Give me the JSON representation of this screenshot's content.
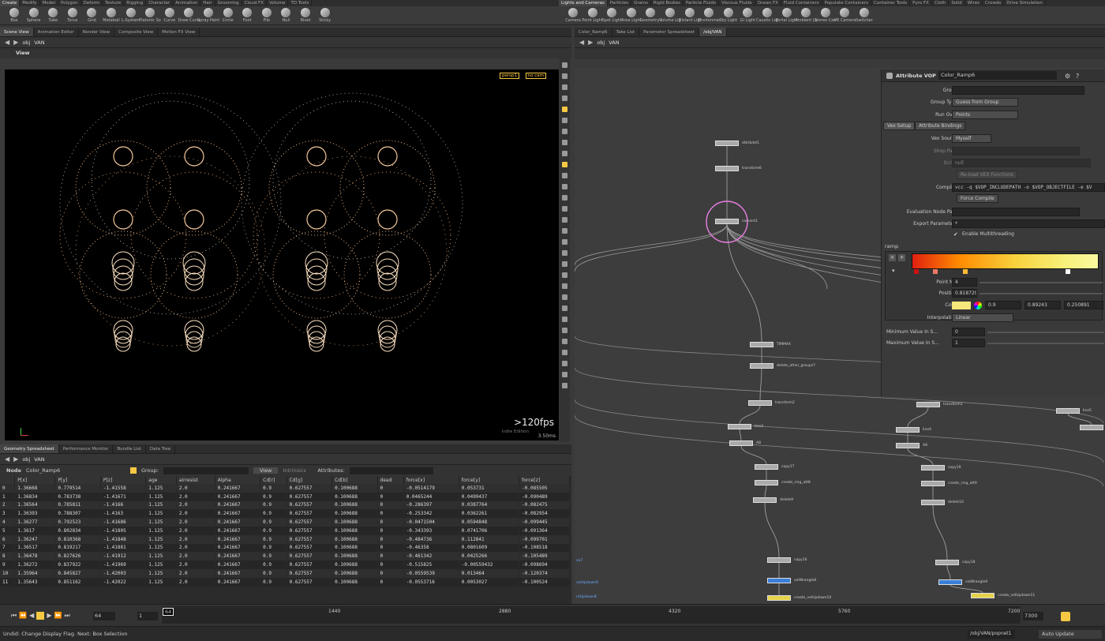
{
  "shelf_tabs_left": [
    "Create",
    "Modify",
    "Model",
    "Polygon",
    "Deform",
    "Texture",
    "Rigging",
    "Character",
    "Animation",
    "Hair",
    "Grooming",
    "Cloud FX",
    "Volume",
    "TD Tools"
  ],
  "shelf_tabs_right": [
    "Lights and Cameras",
    "Particles",
    "Grains",
    "Rigid Bodies",
    "Particle Fluids",
    "Viscous Fluids",
    "Ocean FX",
    "Fluid Containers",
    "Populate Containers",
    "Container Tools",
    "Pyro FX",
    "Cloth",
    "Solid",
    "Wires",
    "Crowds",
    "Drive Simulation"
  ],
  "tools_left": [
    "Box",
    "Sphere",
    "Tube",
    "Torus",
    "Grid",
    "Metaball",
    "L-System",
    "Platonic Sol...",
    "Curve",
    "Draw Curve",
    "Spray Paint",
    "Circle",
    "Font",
    "File",
    "Null",
    "Rivet",
    "Sticky"
  ],
  "tools_right": [
    "Camera",
    "Point Light",
    "Spot Light",
    "Area Light",
    "Geometry L...",
    "Volume Light",
    "Distant Light",
    "Environmen...",
    "Sky Light",
    "GI Light",
    "Caustic Light",
    "Portal Light",
    "Ambient Lig...",
    "Stereo Cam...",
    "VR Camera",
    "Switcher"
  ],
  "left_tabs": [
    "Scene View",
    "Animation Editor",
    "Render View",
    "Composite View",
    "Motion FX View"
  ],
  "right_tabs": [
    "Color_Ramp6",
    "Take List",
    "Parameter Spreadsheet",
    "/obj/VAN"
  ],
  "path": {
    "root": "obj",
    "node": "VAN"
  },
  "viewport": {
    "title": "View",
    "camera": "persp1",
    "cam2": "no cam",
    "fps": ">120fps",
    "fps_sub": "3.50ms",
    "watermark": "Indie Edition"
  },
  "net_nodes": [
    {
      "label": "attribdel1"
    },
    {
      "label": "transform6"
    },
    {
      "label": "convert1"
    },
    {
      "label": "TIMMAX"
    },
    {
      "label": "delete_other_groups7"
    },
    {
      "label": "transform2"
    },
    {
      "label": "line3"
    },
    {
      "label": "A8"
    },
    {
      "label": "copy17"
    },
    {
      "label": "create_ring_att8"
    },
    {
      "label": "delete9"
    },
    {
      "label": "copy16"
    },
    {
      "label": "velWrangle8"
    },
    {
      "label": "create_velUpdown10"
    },
    {
      "label": "transform1"
    },
    {
      "label": "line4"
    },
    {
      "label": "A8"
    },
    {
      "label": "copy19"
    },
    {
      "label": "create_ring_att9"
    },
    {
      "label": "delete10"
    },
    {
      "label": "copy18"
    },
    {
      "label": "velWrangle9"
    },
    {
      "label": "create_velUpdown11"
    },
    {
      "label": "line5"
    },
    {
      "label": "A11"
    }
  ],
  "net_side_labels": [
    "ve7",
    "velUpdown9",
    "ntUpdown8"
  ],
  "params": {
    "type": "Attribute VOP",
    "name": "Color_Ramp6",
    "group_label": "Group",
    "group_type_label": "Group Type",
    "group_type": "Guess from Group",
    "run_over_label": "Run Over",
    "run_over": "Points",
    "tab_vex": "Vex Setup",
    "tab_bind": "Attribute Bindings",
    "vex_source_label": "Vex Source",
    "vex_source": "Myself",
    "shop_path_label": "Shop Path",
    "script_label": "Script",
    "script_value": "null",
    "reload": "Re-load VEX Functions",
    "compiler_label": "Compiler",
    "compiler": "vcc -q $VOP_INCLUDEPATH -o $VOP_OBJECTFILE -e $V",
    "force_compile": "Force Compile",
    "eval_path_label": "Evaluation Node Path",
    "export_label": "Export Parameters",
    "export_value": "*",
    "multithread": "Enable Multithreading",
    "ramp_label": "ramp",
    "point_no_label": "Point No.",
    "point_no": "4",
    "position_label": "Position",
    "position": "0.818729",
    "color_label": "Color",
    "color_r": "0.9",
    "color_g": "0.89243",
    "color_b": "0.250891",
    "interp_label": "Interpolation",
    "interp": "Linear",
    "min_label": "Minimum Value In S...",
    "min_value": "0",
    "max_label": "Maximum Value In S...",
    "max_value": "1"
  },
  "sheet_tabs": [
    "Geometry Spreadsheet",
    "Performance Monitor",
    "Bundle List",
    "Data Tree"
  ],
  "sheet": {
    "node_label": "Node",
    "node": "Color_Ramp6",
    "group_label": "Group:",
    "view": "View",
    "intrinsics": "Intrinsics",
    "attributes_label": "Attributes:",
    "columns": [
      "",
      "P[x]",
      "P[y]",
      "P[z]",
      "age",
      "airresist",
      "Alpha",
      "Cd[r]",
      "Cd[g]",
      "Cd[b]",
      "dead",
      "force[x]",
      "force[y]",
      "force[z]"
    ],
    "rows": [
      [
        "0",
        "1.36668",
        "0.779514",
        "-1.41558",
        "1.125",
        "2.0",
        "0.241667",
        "0.9",
        "0.627557",
        "0.100688",
        "0",
        "-0.0514179",
        "0.053731",
        "-0.085505"
      ],
      [
        "1",
        "1.36834",
        "0.783738",
        "-1.41671",
        "1.125",
        "2.0",
        "0.241667",
        "0.9",
        "0.627557",
        "0.100688",
        "0",
        "0.0465244",
        "0.0499437",
        "-0.090489"
      ],
      [
        "2",
        "1.36564",
        "0.785811",
        "-1.4166",
        "1.125",
        "2.0",
        "0.241667",
        "0.9",
        "0.627557",
        "0.100688",
        "0",
        "-0.286397",
        "0.0387764",
        "-0.082475"
      ],
      [
        "3",
        "1.36393",
        "0.788307",
        "-1.4163",
        "1.125",
        "2.0",
        "0.241667",
        "0.9",
        "0.627557",
        "0.100688",
        "0",
        "-0.253342",
        "0.0362261",
        "-0.082954"
      ],
      [
        "4",
        "1.36277",
        "0.792523",
        "-1.41686",
        "1.125",
        "2.0",
        "0.241667",
        "0.9",
        "0.627557",
        "0.100688",
        "0",
        "-0.0471504",
        "0.0594848",
        "-0.099445"
      ],
      [
        "5",
        "1.3617",
        "0.802834",
        "-1.41805",
        "1.125",
        "2.0",
        "0.241667",
        "0.9",
        "0.627557",
        "0.100688",
        "0",
        "-0.343393",
        "0.0741706",
        "-0.091364"
      ],
      [
        "6",
        "1.36247",
        "0.810368",
        "-1.41848",
        "1.125",
        "2.0",
        "0.241667",
        "0.9",
        "0.627557",
        "0.100688",
        "0",
        "-0.484736",
        "0.112841",
        "-0.099701"
      ],
      [
        "7",
        "1.36517",
        "0.819217",
        "-1.41881",
        "1.125",
        "2.0",
        "0.241667",
        "0.9",
        "0.627557",
        "0.100688",
        "0",
        "-0.46358",
        "0.0801609",
        "-0.108518"
      ],
      [
        "8",
        "1.36478",
        "0.827626",
        "-1.41912",
        "1.125",
        "2.0",
        "0.241667",
        "0.9",
        "0.627557",
        "0.100688",
        "0",
        "-0.461342",
        "0.0425266",
        "-0.105489"
      ],
      [
        "9",
        "1.36272",
        "0.837922",
        "-1.41969",
        "1.125",
        "2.0",
        "0.241667",
        "0.9",
        "0.627557",
        "0.100688",
        "0",
        "-0.515825",
        "-0.00559432",
        "-0.098694"
      ],
      [
        "10",
        "1.35964",
        "0.845827",
        "-1.42003",
        "1.125",
        "2.0",
        "0.241667",
        "0.9",
        "0.627557",
        "0.100688",
        "0",
        "-0.0559539",
        "0.013464",
        "-0.120374"
      ],
      [
        "11",
        "1.35643",
        "0.851162",
        "-1.42022",
        "1.125",
        "2.0",
        "0.241667",
        "0.9",
        "0.627557",
        "0.100688",
        "0",
        "-0.0553716",
        "0.0053027",
        "-0.100524"
      ]
    ]
  },
  "timeline": {
    "frame": "64",
    "start": "1",
    "ticks": [
      "1440",
      "2880",
      "4320",
      "5760",
      "7200"
    ],
    "current_marker": "64",
    "end": "7300"
  },
  "status": {
    "message": "Undid: Change Display Flag. Next: Box Selection",
    "path": "/obj/VAN/popnet1",
    "update": "Auto Update"
  },
  "colors": {
    "accent": "#f7c843",
    "selection": "#e87fe2"
  }
}
